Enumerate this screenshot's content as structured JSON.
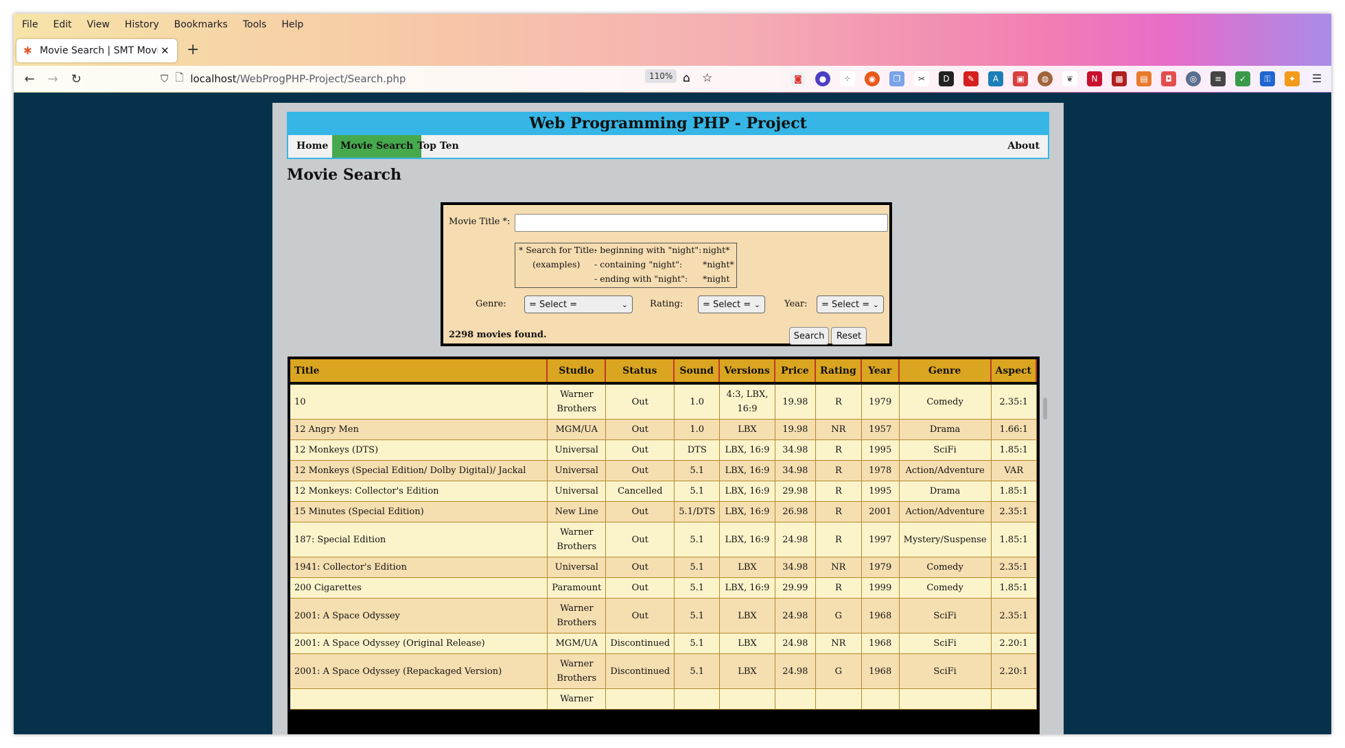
{
  "browser": {
    "menu": [
      "File",
      "Edit",
      "View",
      "History",
      "Bookmarks",
      "Tools",
      "Help"
    ],
    "tab_title": "Movie Search | SMT Movie",
    "url_host": "localhost",
    "url_path": "/WebProgPHP-Project/Search.php",
    "zoom": "110%"
  },
  "site": {
    "banner": "Web Programming PHP - Project",
    "nav": {
      "home": "Home",
      "search": "Movie Search",
      "topten": "Top Ten",
      "about": "About"
    },
    "heading": "Movie Search"
  },
  "form": {
    "title_label": "Movie Title *:",
    "title_value": "",
    "tips": {
      "head1": "* Search for Title:",
      "head2": "(examples)",
      "l1": "- beginning with \"night\":",
      "l2": "- containing \"night\":",
      "l3": "- ending with \"night\":",
      "v1": "night*",
      "v2": "*night*",
      "v3": "*night"
    },
    "genre_label": "Genre:",
    "genre_value": "= Select =",
    "rating_label": "Rating:",
    "rating_value": "= Select =",
    "year_label": "Year:",
    "year_value": "= Select =",
    "count": "2298 movies found.",
    "search_btn": "Search",
    "reset_btn": "Reset"
  },
  "table": {
    "headers": [
      "Title",
      "Studio",
      "Status",
      "Sound",
      "Versions",
      "Price",
      "Rating",
      "Year",
      "Genre",
      "Aspect"
    ],
    "rows": [
      [
        "10",
        "Warner Brothers",
        "Out",
        "1.0",
        "4:3, LBX, 16:9",
        "19.98",
        "R",
        "1979",
        "Comedy",
        "2.35:1"
      ],
      [
        "12 Angry Men",
        "MGM/UA",
        "Out",
        "1.0",
        "LBX",
        "19.98",
        "NR",
        "1957",
        "Drama",
        "1.66:1"
      ],
      [
        "12 Monkeys (DTS)",
        "Universal",
        "Out",
        "DTS",
        "LBX, 16:9",
        "34.98",
        "R",
        "1995",
        "SciFi",
        "1.85:1"
      ],
      [
        "12 Monkeys (Special Edition/ Dolby Digital)/ Jackal",
        "Universal",
        "Out",
        "5.1",
        "LBX, 16:9",
        "34.98",
        "R",
        "1978",
        "Action/Adventure",
        "VAR"
      ],
      [
        "12 Monkeys: Collector's Edition",
        "Universal",
        "Cancelled",
        "5.1",
        "LBX, 16:9",
        "29.98",
        "R",
        "1995",
        "Drama",
        "1.85:1"
      ],
      [
        "15 Minutes (Special Edition)",
        "New Line",
        "Out",
        "5.1/DTS",
        "LBX, 16:9",
        "26.98",
        "R",
        "2001",
        "Action/Adventure",
        "2.35:1"
      ],
      [
        "187: Special Edition",
        "Warner Brothers",
        "Out",
        "5.1",
        "LBX, 16:9",
        "24.98",
        "R",
        "1997",
        "Mystery/Suspense",
        "1.85:1"
      ],
      [
        "1941: Collector's Edition",
        "Universal",
        "Out",
        "5.1",
        "LBX",
        "34.98",
        "NR",
        "1979",
        "Comedy",
        "2.35:1"
      ],
      [
        "200 Cigarettes",
        "Paramount",
        "Out",
        "5.1",
        "LBX, 16:9",
        "29.99",
        "R",
        "1999",
        "Comedy",
        "1.85:1"
      ],
      [
        "2001: A Space Odyssey",
        "Warner Brothers",
        "Out",
        "5.1",
        "LBX",
        "24.98",
        "G",
        "1968",
        "SciFi",
        "2.35:1"
      ],
      [
        "2001: A Space Odyssey (Original Release)",
        "MGM/UA",
        "Discontinued",
        "5.1",
        "LBX",
        "24.98",
        "NR",
        "1968",
        "SciFi",
        "2.20:1"
      ],
      [
        "2001: A Space Odyssey (Repackaged Version)",
        "Warner Brothers",
        "Discontinued",
        "5.1",
        "LBX",
        "24.98",
        "G",
        "1968",
        "SciFi",
        "2.20:1"
      ],
      [
        "",
        "Warner",
        "",
        "",
        "",
        "",
        "",
        "",
        "",
        ""
      ]
    ]
  }
}
